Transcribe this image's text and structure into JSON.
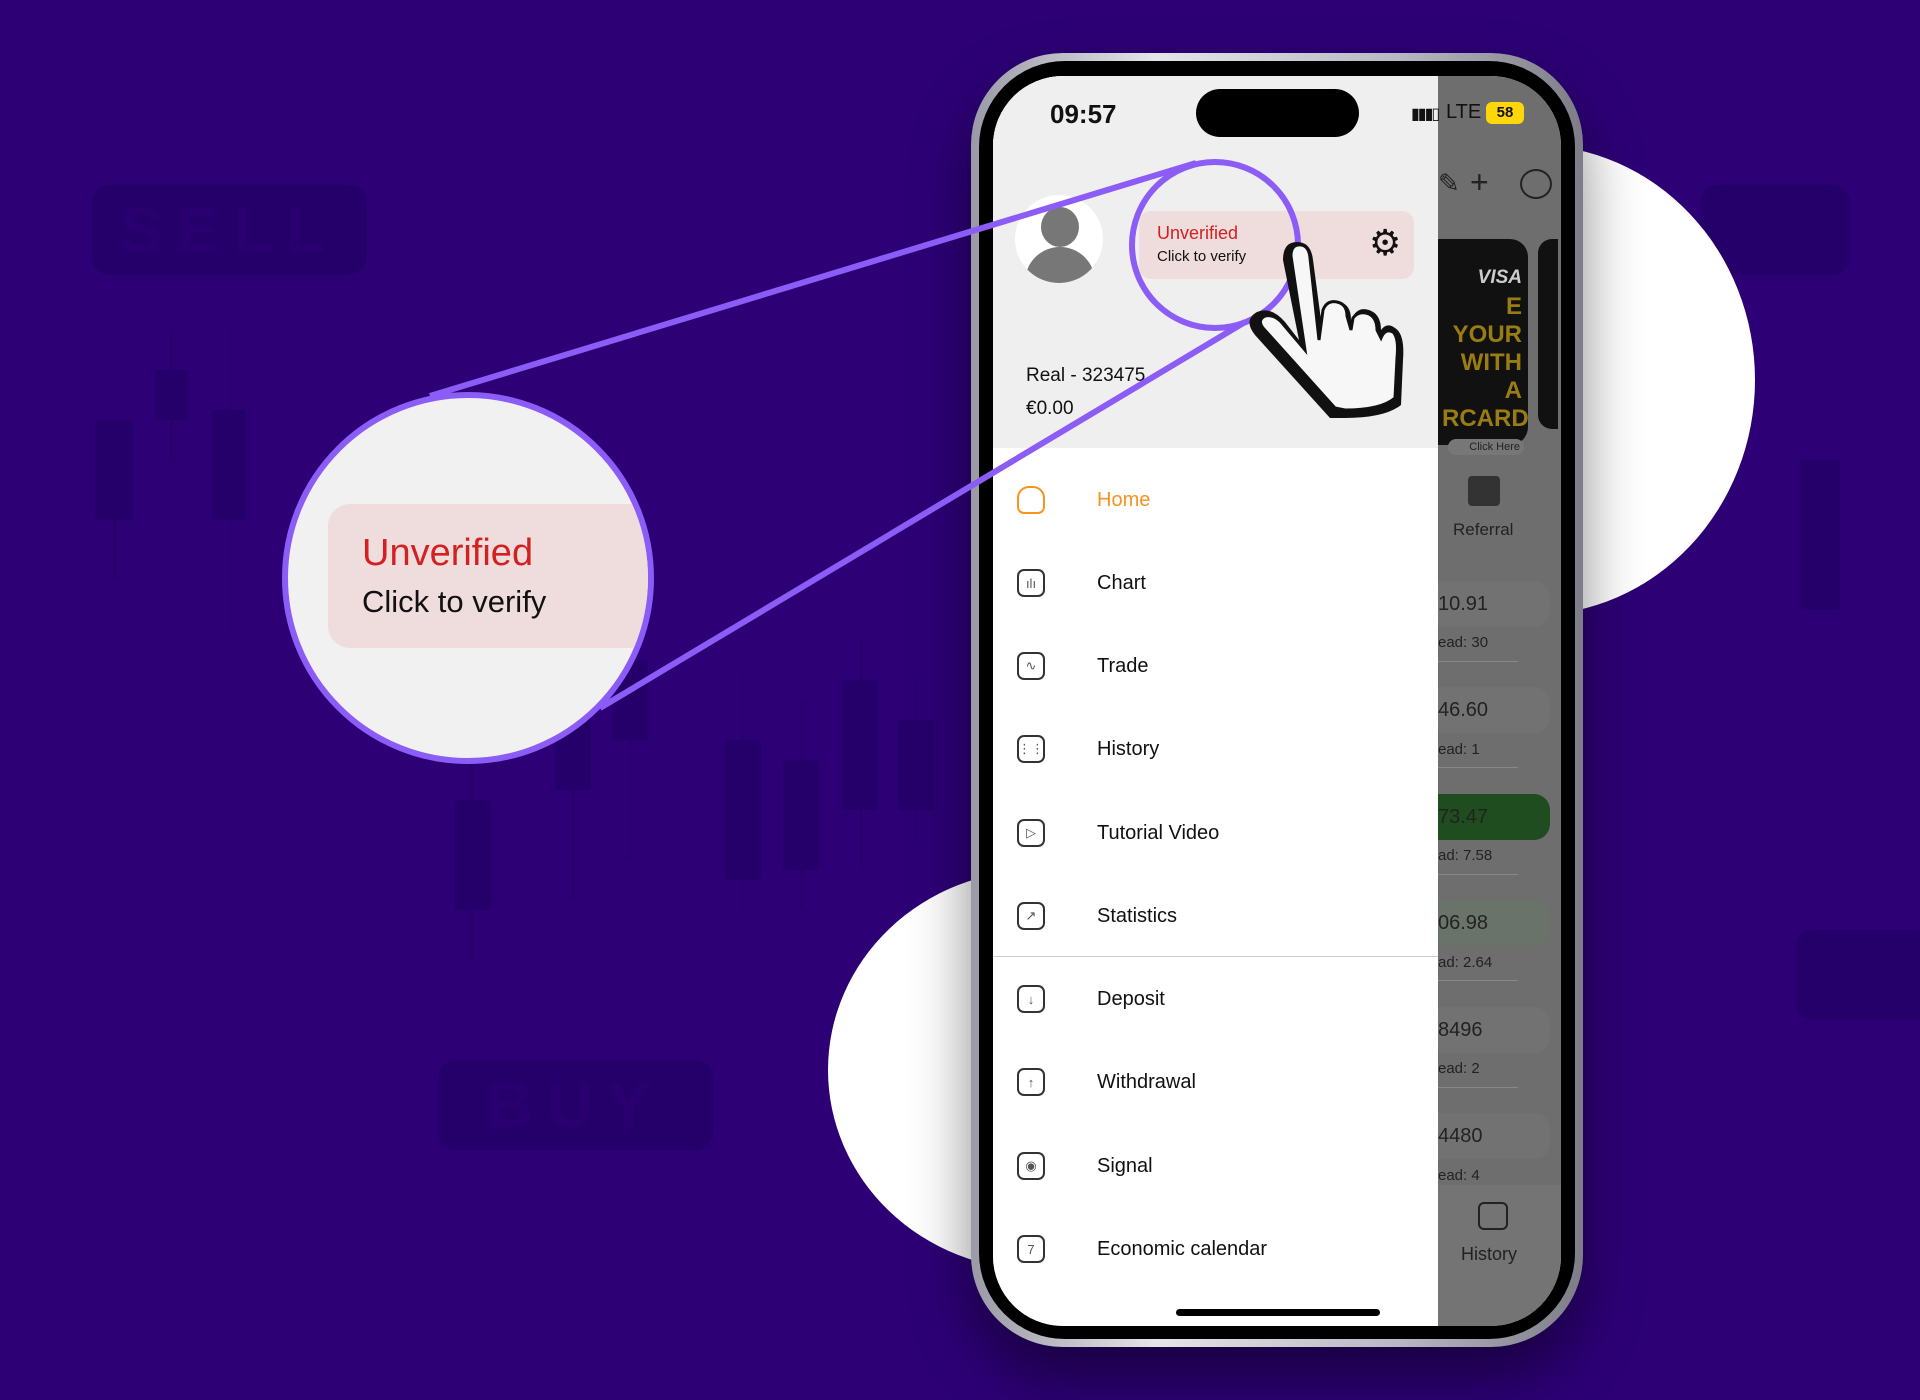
{
  "background": {
    "color": "#2d0076",
    "ghost_labels": [
      "SELL",
      "BUY"
    ]
  },
  "status_bar": {
    "time": "09:57",
    "network": "LTE",
    "battery": "58"
  },
  "drawer": {
    "verification": {
      "status": "Unverified",
      "action": "Click to verify",
      "status_color": "#d32020"
    },
    "account": {
      "label": "Real - 323475",
      "balance": "€0.00"
    },
    "menu": [
      {
        "label": "Home",
        "icon": "home-icon",
        "active": true
      },
      {
        "label": "Chart",
        "icon": "chart-icon"
      },
      {
        "label": "Trade",
        "icon": "trade-icon"
      },
      {
        "label": "History",
        "icon": "calendar-icon"
      },
      {
        "label": "Tutorial Video",
        "icon": "video-icon"
      },
      {
        "label": "Statistics",
        "icon": "statistics-icon"
      },
      {
        "label": "Deposit",
        "icon": "deposit-icon"
      },
      {
        "label": "Withdrawal",
        "icon": "withdrawal-icon"
      },
      {
        "label": "Signal",
        "icon": "signal-icon"
      },
      {
        "label": "Economic calendar",
        "icon": "economic-calendar-icon"
      }
    ],
    "active_color": "#f7931e"
  },
  "background_app": {
    "banner": {
      "brands": "VISA",
      "lines": [
        "E YOUR",
        "WITH A",
        "RCARD"
      ],
      "cta": "Click Here"
    },
    "referral_label": "Referral",
    "rows": [
      {
        "value": "10.91",
        "spread": "ead: 30"
      },
      {
        "value": "46.60",
        "spread": "ead: 1"
      },
      {
        "value": "73.47",
        "spread": "ad: 7.58",
        "highlight": "green"
      },
      {
        "value": "06.98",
        "spread": "ad: 2.64"
      },
      {
        "value": "8496",
        "spread": "ead: 2"
      },
      {
        "value": "4480",
        "spread": "ead: 4"
      }
    ],
    "bottom_tab": "History"
  },
  "magnifier": {
    "status": "Unverified",
    "action": "Click to verify",
    "ring_color": "#8b5cf6"
  }
}
